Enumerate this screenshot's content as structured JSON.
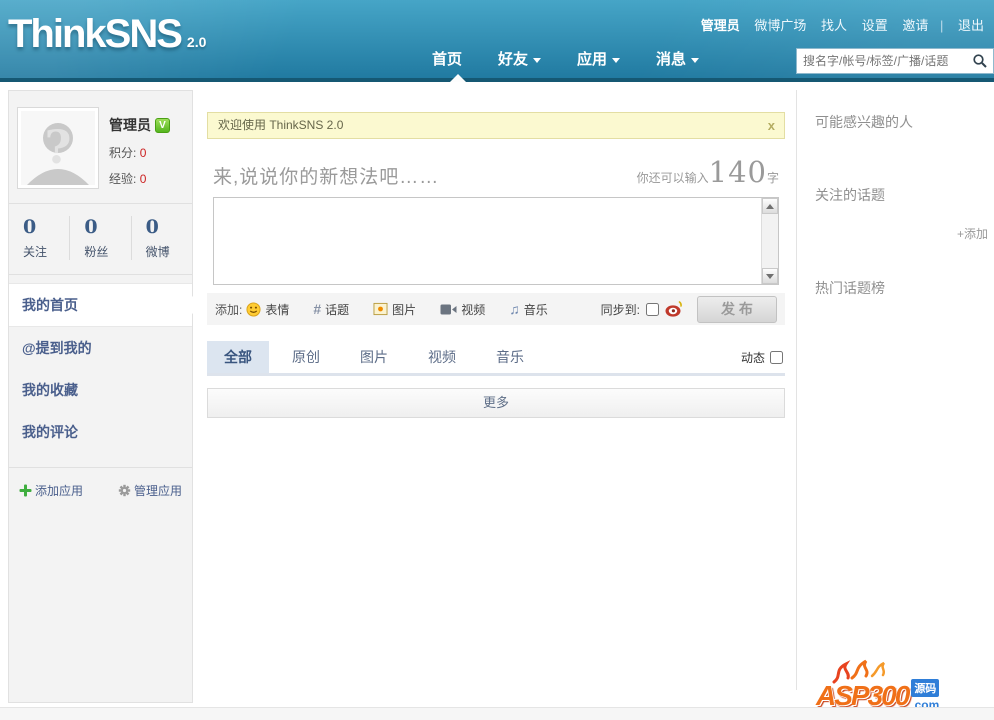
{
  "header": {
    "logo": "ThinkSNS",
    "version": "2.0",
    "top_links": [
      "管理员",
      "微博广场",
      "找人",
      "设置",
      "邀请",
      "退出"
    ],
    "separator": "|",
    "nav": [
      {
        "label": "首页",
        "active": true
      },
      {
        "label": "好友",
        "dropdown": true
      },
      {
        "label": "应用",
        "dropdown": true
      },
      {
        "label": "消息",
        "dropdown": true
      }
    ],
    "search_placeholder": "搜名字/帐号/标签/广播/话题"
  },
  "sidebar": {
    "username": "管理员",
    "badge": "V",
    "avatar_glyph": "?",
    "score_label": "积分:",
    "score_value": "0",
    "exp_label": "经验:",
    "exp_value": "0",
    "stats": [
      {
        "value": "0",
        "label": "关注"
      },
      {
        "value": "0",
        "label": "粉丝"
      },
      {
        "value": "0",
        "label": "微博"
      }
    ],
    "menu": [
      "我的首页",
      "@提到我的",
      "我的收藏",
      "我的评论"
    ],
    "add_app": "添加应用",
    "manage_app": "管理应用"
  },
  "main": {
    "banner_text": "欢迎使用 ThinkSNS 2.0",
    "banner_close": "x",
    "composer": {
      "prompt": "来,说说你的新想法吧……",
      "counter_prefix": "你还可以输入",
      "counter_value": "140",
      "counter_suffix": "字",
      "add_label": "添加:",
      "tools": [
        "表情",
        "话题",
        "图片",
        "视频",
        "音乐"
      ],
      "hash_glyph": "#",
      "music_glyph": "♫",
      "sync_label": "同步到:",
      "publish_label": "发 布"
    },
    "tabs": [
      "全部",
      "原创",
      "图片",
      "视频",
      "音乐"
    ],
    "active_tab": "全部",
    "dynamic_label": "动态",
    "more_label": "更多"
  },
  "right_sidebar": {
    "section_interesting_people": "可能感兴趣的人",
    "section_followed_topics": "关注的话题",
    "section_hot_topics": "热门话题榜",
    "add_link": "+添加"
  },
  "watermark": {
    "part1": "ASP300",
    "part2": "源码",
    "part3": ".com"
  },
  "colors": {
    "header_gradient_top": "#46a5c7",
    "header_gradient_bottom": "#1f789f",
    "header_strip": "#155873",
    "banner_bg": "#fbf9d0",
    "tab_active_bg": "#dce5f0",
    "link_navy": "#4a5f8c",
    "value_red": "#cc2222",
    "stat_num_blue": "#3b5c86"
  }
}
